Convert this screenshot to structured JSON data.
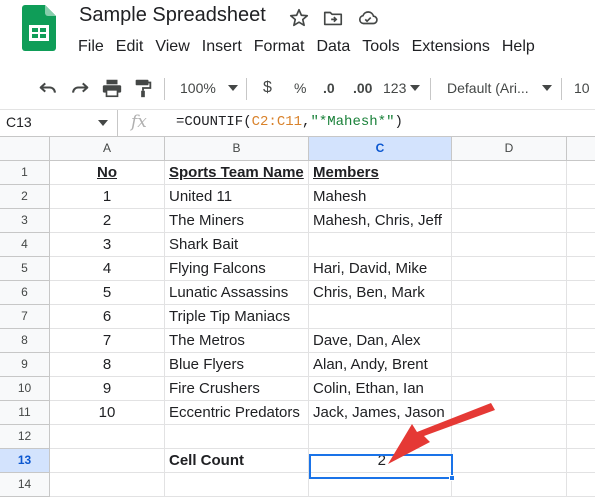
{
  "app": {
    "title": "Sample Spreadsheet",
    "brand_green": "#0f9d58",
    "accent_blue": "#1a73e8",
    "annotation_red": "#e53935"
  },
  "title_icons": [
    "star-icon",
    "move-to-folder-icon",
    "cloud-status-icon"
  ],
  "menu": [
    "File",
    "Edit",
    "View",
    "Insert",
    "Format",
    "Data",
    "Tools",
    "Extensions",
    "Help"
  ],
  "toolbar": {
    "undo_icon": "undo-icon",
    "redo_icon": "redo-icon",
    "print_icon": "print-icon",
    "paint_format_icon": "paint-format-icon",
    "zoom": "100%",
    "currency": "$",
    "percent": "%",
    "decrease_decimal": ".0",
    "increase_decimal": ".00",
    "more_formats": "123",
    "font": "Default (Ari...",
    "font_size": "10"
  },
  "formula_bar": {
    "cell_ref": "C13",
    "fx_label": "fx",
    "formula_prefix": "=COUNTIF(",
    "formula_range": "C2:C11",
    "formula_sep": ",",
    "formula_criteria": "\"*Mahesh*\"",
    "formula_suffix": ")"
  },
  "grid": {
    "columns": [
      "A",
      "B",
      "C",
      "D"
    ],
    "selected_column": "C",
    "selected_row": "13",
    "rows": [
      {
        "num": "1",
        "a": "No",
        "b": "Sports Team Name",
        "c": "Members"
      },
      {
        "num": "2",
        "a": "1",
        "b": "United 11",
        "c": "Mahesh"
      },
      {
        "num": "3",
        "a": "2",
        "b": "The Miners",
        "c": "Mahesh, Chris, Jeff"
      },
      {
        "num": "4",
        "a": "3",
        "b": "Shark Bait",
        "c": ""
      },
      {
        "num": "5",
        "a": "4",
        "b": "Flying Falcons",
        "c": "Hari, David, Mike"
      },
      {
        "num": "6",
        "a": "5",
        "b": "Lunatic Assassins",
        "c": "Chris, Ben, Mark"
      },
      {
        "num": "7",
        "a": "6",
        "b": "Triple Tip Maniacs",
        "c": ""
      },
      {
        "num": "8",
        "a": "7",
        "b": "The Metros",
        "c": "Dave, Dan, Alex"
      },
      {
        "num": "9",
        "a": "8",
        "b": "Blue Flyers",
        "c": "Alan, Andy, Brent"
      },
      {
        "num": "10",
        "a": "9",
        "b": "Fire Crushers",
        "c": "Colin, Ethan, Ian"
      },
      {
        "num": "11",
        "a": "10",
        "b": "Eccentric Predators",
        "c": "Jack, James, Jason"
      },
      {
        "num": "12",
        "a": "",
        "b": "",
        "c": ""
      },
      {
        "num": "13",
        "a": "",
        "b": "Cell Count",
        "c": "2"
      },
      {
        "num": "14",
        "a": "",
        "b": "",
        "c": ""
      }
    ]
  }
}
